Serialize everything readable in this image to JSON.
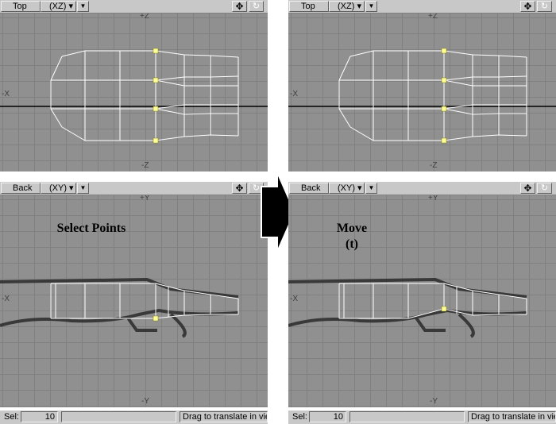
{
  "left_panel": {
    "top_viewport": {
      "view_name": "Top",
      "plane": "(XZ)",
      "axis_top": "+Z",
      "axis_left": "-X",
      "axis_bottom": "-Z"
    },
    "back_viewport": {
      "view_name": "Back",
      "plane": "(XY)",
      "axis_top": "+Y",
      "axis_left": "-X",
      "axis_bottom": "-Y"
    },
    "caption_line1": "Select Points",
    "caption_line2": "",
    "status": {
      "sel_label": "Sel:",
      "sel_count": "10",
      "message": "Drag to translate in vie"
    }
  },
  "right_panel": {
    "top_viewport": {
      "view_name": "Top",
      "plane": "(XZ)",
      "axis_top": "+Z",
      "axis_left": "-X",
      "axis_bottom": "-Z"
    },
    "back_viewport": {
      "view_name": "Back",
      "plane": "(XY)",
      "axis_top": "+Y",
      "axis_left": "-X",
      "axis_bottom": "-Y"
    },
    "caption_line1": "Move",
    "caption_line2": "(t)",
    "status": {
      "sel_label": "Sel:",
      "sel_count": "10",
      "message": "Drag to translate in vie"
    }
  },
  "icons": {
    "menu": "dropdown-triangle-icon",
    "move": "move-cross-icon",
    "rotate": "rotate-icon",
    "arrow": "right-arrow-icon"
  },
  "colors": {
    "viewport_bg": "#909090",
    "grid": "#808080",
    "wire": "#ffffff",
    "selected_point": "#ffff99",
    "toolbar": "#c8c8c8"
  }
}
